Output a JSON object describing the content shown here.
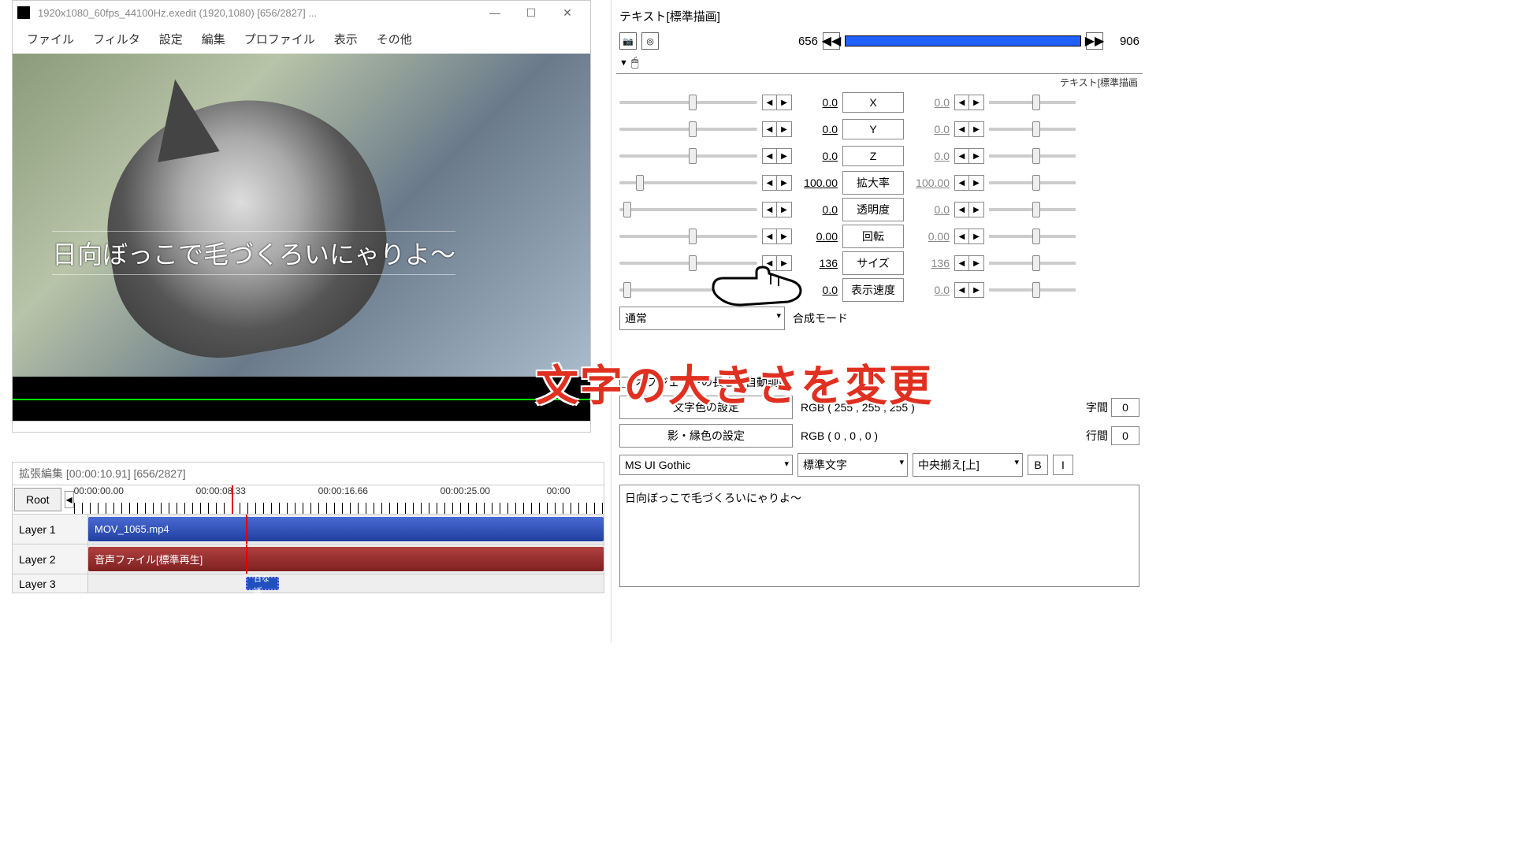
{
  "main_window": {
    "title": "1920x1080_60fps_44100Hz.exedit (1920,1080) [656/2827] ...",
    "menu": [
      "ファイル",
      "フィルタ",
      "設定",
      "編集",
      "プロファイル",
      "表示",
      "その他"
    ],
    "overlay_text": "日向ぼっこで毛づくろいにゃりよ〜"
  },
  "ext_edit": {
    "title": "拡張編集 [00:00:10.91] [656/2827]",
    "root": "Root",
    "times": [
      "00:00:00.00",
      "00:00:08.33",
      "00:00:16.66",
      "00:00:25.00",
      "00:00"
    ],
    "layers": [
      {
        "name": "Layer 1",
        "clip": "MOV_1065.mp4",
        "type": "video"
      },
      {
        "name": "Layer 2",
        "clip": "音声ファイル[標準再生]",
        "type": "audio"
      },
      {
        "name": "Layer 3",
        "clip": "日なぼ",
        "type": "text"
      }
    ]
  },
  "prop": {
    "title": "テキスト[標準描画]",
    "frame_start": "656",
    "frame_end": "906",
    "section": "テキスト[標準描画",
    "params": [
      {
        "label": "X",
        "v1": "0.0",
        "v2": "0.0",
        "pos": 50
      },
      {
        "label": "Y",
        "v1": "0.0",
        "v2": "0.0",
        "pos": 50
      },
      {
        "label": "Z",
        "v1": "0.0",
        "v2": "0.0",
        "pos": 50
      },
      {
        "label": "拡大率",
        "v1": "100.00",
        "v2": "100.00",
        "pos": 12
      },
      {
        "label": "透明度",
        "v1": "0.0",
        "v2": "0.0",
        "pos": 3
      },
      {
        "label": "回転",
        "v1": "0.00",
        "v2": "0.00",
        "pos": 50
      },
      {
        "label": "サイズ",
        "v1": "136",
        "v2": "136",
        "pos": 50,
        "highlight": true
      },
      {
        "label": "表示速度",
        "v1": "0.0",
        "v2": "0.0",
        "pos": 3
      }
    ],
    "blend_mode": "通常",
    "blend_label": "合成モード",
    "auto_length": "オブジェクトの長さを自動調節",
    "text_color_btn": "文字色の設定",
    "text_color_val": "RGB ( 255 , 255 , 255 )",
    "shadow_color_btn": "影・縁色の設定",
    "shadow_color_val": "RGB ( 0 , 0 , 0 )",
    "spacing_char_label": "字間",
    "spacing_char": "0",
    "spacing_line_label": "行間",
    "spacing_line": "0",
    "font": "MS UI Gothic",
    "style": "標準文字",
    "align": "中央揃え[上]",
    "bold": "B",
    "italic": "I",
    "text_content": "日向ぼっこで毛づくろいにゃりよ〜"
  },
  "annotation": "文字の大きさを変更"
}
